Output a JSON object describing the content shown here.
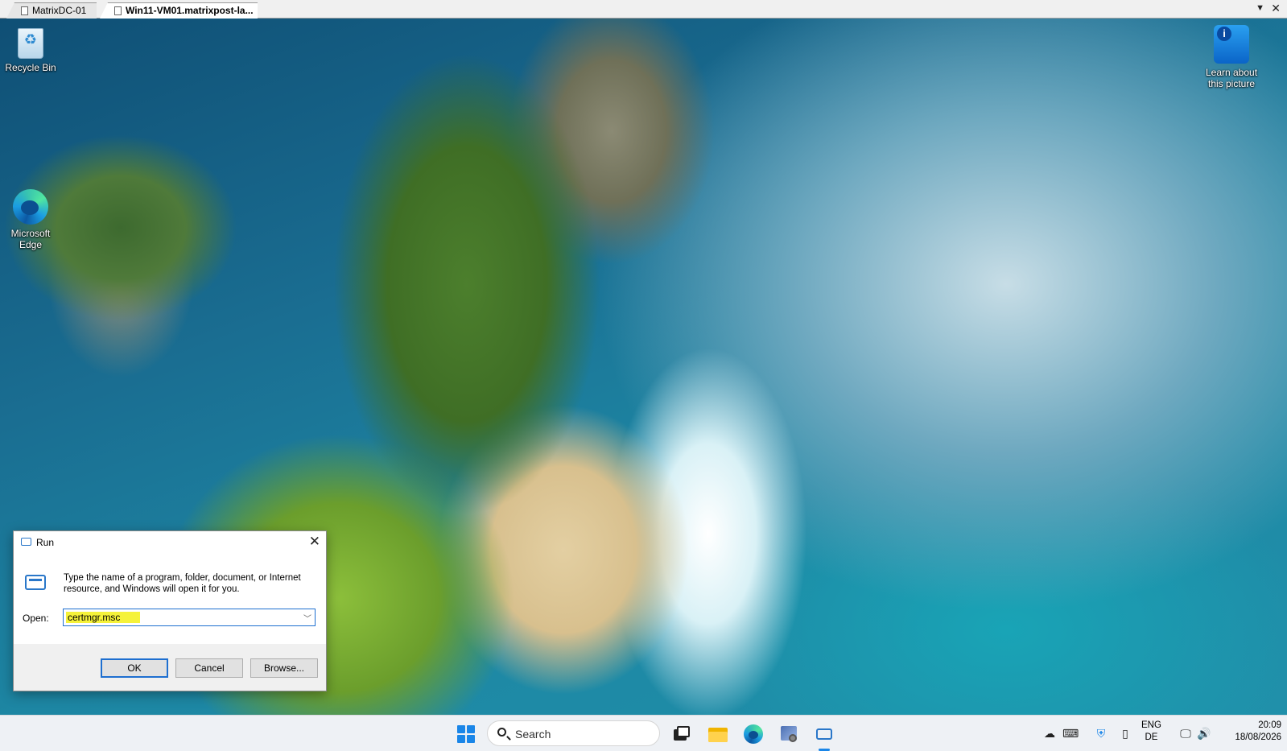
{
  "rdp_tabs": [
    {
      "label": "MatrixDC-01",
      "active": false
    },
    {
      "label": "Win11-VM01.matrixpost-la...",
      "active": true
    }
  ],
  "desktop": {
    "icons": [
      {
        "label": "Recycle Bin"
      },
      {
        "label": "Microsoft Edge"
      },
      {
        "label": "Learn about this picture"
      }
    ]
  },
  "run_dialog": {
    "title": "Run",
    "description": "Type the name of a program, folder, document, or Internet resource, and Windows will open it for you.",
    "open_label": "Open:",
    "open_value": "certmgr.msc",
    "ok_label": "OK",
    "cancel_label": "Cancel",
    "browse_label": "Browse...",
    "highlight_color": "#f5f23a"
  },
  "taskbar": {
    "search_label": "Search",
    "apps": [
      "task-view",
      "file-explorer",
      "microsoft-edge",
      "administrative-tools",
      "run"
    ],
    "tray": {
      "language_line1": "ENG",
      "language_line2": "DE",
      "time": "20:09",
      "date": "18/08/2026"
    },
    "accent_color": "#1a86e8"
  }
}
